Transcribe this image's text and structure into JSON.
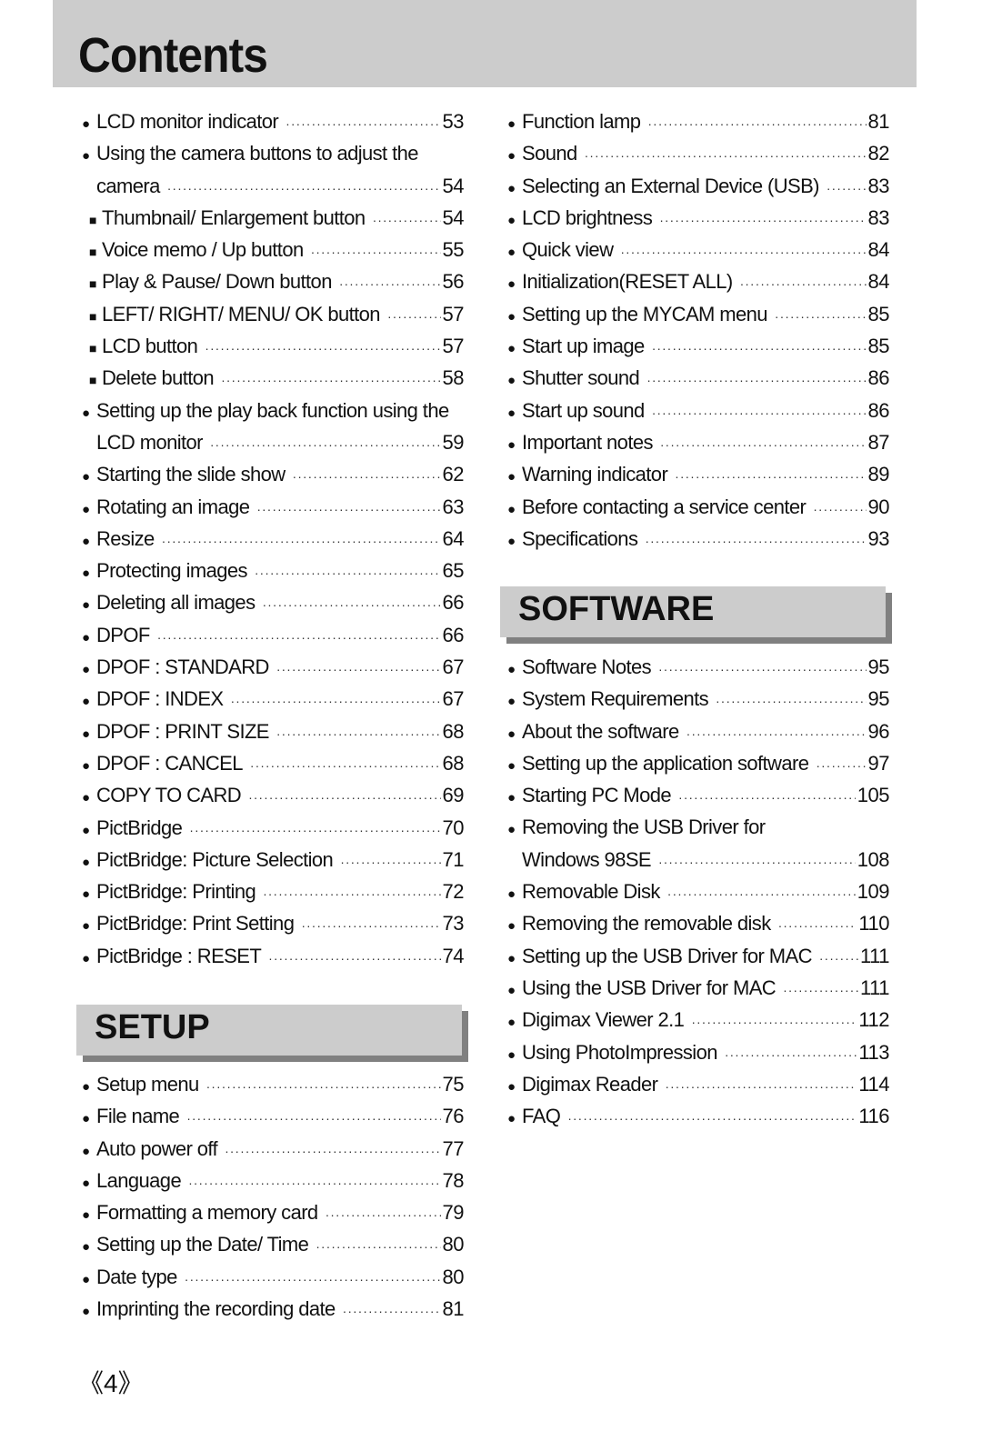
{
  "title": "Contents",
  "left_column": {
    "entries": [
      {
        "bullet": "●",
        "label": "LCD monitor indicator",
        "page": "53",
        "level": "main"
      },
      {
        "bullet": "●",
        "label": "Using the camera buttons to adjust the",
        "page": "",
        "level": "main"
      },
      {
        "bullet": "",
        "label": "camera",
        "page": "54",
        "level": "cont"
      },
      {
        "bullet": "■",
        "label": "Thumbnail/ Enlargement button",
        "page": "54",
        "level": "sub"
      },
      {
        "bullet": "■",
        "label": "Voice memo / Up button",
        "page": "55",
        "level": "sub"
      },
      {
        "bullet": "■",
        "label": "Play & Pause/ Down button",
        "page": "56",
        "level": "sub"
      },
      {
        "bullet": "■",
        "label": "LEFT/ RIGHT/ MENU/ OK button",
        "page": "57",
        "level": "sub"
      },
      {
        "bullet": "■",
        "label": "LCD button",
        "page": "57",
        "level": "sub"
      },
      {
        "bullet": "■",
        "label": "Delete button",
        "page": "58",
        "level": "sub"
      },
      {
        "bullet": "●",
        "label": "Setting up the play back function using the",
        "page": "",
        "level": "main"
      },
      {
        "bullet": "",
        "label": "LCD monitor",
        "page": "59",
        "level": "cont"
      },
      {
        "bullet": "●",
        "label": "Starting the slide show",
        "page": "62",
        "level": "main"
      },
      {
        "bullet": "●",
        "label": "Rotating an image",
        "page": "63",
        "level": "main"
      },
      {
        "bullet": "●",
        "label": "Resize",
        "page": "64",
        "level": "main"
      },
      {
        "bullet": "●",
        "label": "Protecting images",
        "page": "65",
        "level": "main"
      },
      {
        "bullet": "●",
        "label": "Deleting all images",
        "page": "66",
        "level": "main"
      },
      {
        "bullet": "●",
        "label": "DPOF",
        "page": "66",
        "level": "main"
      },
      {
        "bullet": "●",
        "label": "DPOF : STANDARD",
        "page": "67",
        "level": "main"
      },
      {
        "bullet": "●",
        "label": "DPOF : INDEX",
        "page": "67",
        "level": "main"
      },
      {
        "bullet": "●",
        "label": "DPOF : PRINT SIZE",
        "page": "68",
        "level": "main"
      },
      {
        "bullet": "●",
        "label": "DPOF : CANCEL",
        "page": "68",
        "level": "main"
      },
      {
        "bullet": "●",
        "label": "COPY TO CARD",
        "page": "69",
        "level": "main"
      },
      {
        "bullet": "●",
        "label": "PictBridge",
        "page": "70",
        "level": "main"
      },
      {
        "bullet": "●",
        "label": "PictBridge: Picture Selection",
        "page": "71",
        "level": "main"
      },
      {
        "bullet": "●",
        "label": "PictBridge: Printing",
        "page": "72",
        "level": "main"
      },
      {
        "bullet": "●",
        "label": "PictBridge: Print Setting",
        "page": "73",
        "level": "main"
      },
      {
        "bullet": "●",
        "label": "PictBridge : RESET",
        "page": "74",
        "level": "main"
      }
    ]
  },
  "setup_section": {
    "heading": "SETUP",
    "entries": [
      {
        "bullet": "●",
        "label": "Setup menu",
        "page": "75",
        "level": "main"
      },
      {
        "bullet": "●",
        "label": "File name",
        "page": "76",
        "level": "main"
      },
      {
        "bullet": "●",
        "label": "Auto power off",
        "page": "77",
        "level": "main"
      },
      {
        "bullet": "●",
        "label": "Language",
        "page": "78",
        "level": "main"
      },
      {
        "bullet": "●",
        "label": "Formatting a memory card",
        "page": "79",
        "level": "main"
      },
      {
        "bullet": "●",
        "label": "Setting up the Date/ Time",
        "page": "80",
        "level": "main"
      },
      {
        "bullet": "●",
        "label": "Date type",
        "page": "80",
        "level": "main"
      },
      {
        "bullet": "●",
        "label": "Imprinting the recording date",
        "page": "81",
        "level": "main"
      }
    ]
  },
  "right_column": {
    "entries": [
      {
        "bullet": "●",
        "label": "Function lamp",
        "page": "81",
        "level": "main"
      },
      {
        "bullet": "●",
        "label": "Sound",
        "page": "82",
        "level": "main"
      },
      {
        "bullet": "●",
        "label": "Selecting an External Device (USB)",
        "page": "83",
        "level": "main"
      },
      {
        "bullet": "●",
        "label": "LCD brightness",
        "page": "83",
        "level": "main"
      },
      {
        "bullet": "●",
        "label": "Quick view",
        "page": "84",
        "level": "main"
      },
      {
        "bullet": "●",
        "label": "Initialization(RESET ALL)",
        "page": "84",
        "level": "main"
      },
      {
        "bullet": "●",
        "label": "Setting up the MYCAM menu",
        "page": "85",
        "level": "main"
      },
      {
        "bullet": "●",
        "label": "Start up image",
        "page": "85",
        "level": "main"
      },
      {
        "bullet": "●",
        "label": "Shutter sound",
        "page": "86",
        "level": "main"
      },
      {
        "bullet": "●",
        "label": "Start up sound",
        "page": "86",
        "level": "main"
      },
      {
        "bullet": "●",
        "label": "Important notes",
        "page": "87",
        "level": "main"
      },
      {
        "bullet": "●",
        "label": "Warning indicator",
        "page": "89",
        "level": "main"
      },
      {
        "bullet": "●",
        "label": "Before contacting a service center",
        "page": "90",
        "level": "main"
      },
      {
        "bullet": "●",
        "label": "Specifications",
        "page": "93",
        "level": "main"
      }
    ]
  },
  "software_section": {
    "heading": "SOFTWARE",
    "entries": [
      {
        "bullet": "●",
        "label": "Software Notes",
        "page": "95",
        "level": "main"
      },
      {
        "bullet": "●",
        "label": "System Requirements",
        "page": "95",
        "level": "main"
      },
      {
        "bullet": "●",
        "label": "About the software",
        "page": "96",
        "level": "main"
      },
      {
        "bullet": "●",
        "label": "Setting up the application software",
        "page": "97",
        "level": "main"
      },
      {
        "bullet": "●",
        "label": "Starting PC Mode",
        "page": "105",
        "level": "main"
      },
      {
        "bullet": "●",
        "label": "Removing the USB Driver for",
        "page": "",
        "level": "main"
      },
      {
        "bullet": "",
        "label": "Windows 98SE",
        "page": "108",
        "level": "cont"
      },
      {
        "bullet": "●",
        "label": "Removable Disk",
        "page": "109",
        "level": "main"
      },
      {
        "bullet": "●",
        "label": "Removing the removable disk",
        "page": "110",
        "level": "main"
      },
      {
        "bullet": "●",
        "label": "Setting up the USB Driver for MAC",
        "page": "111",
        "level": "main"
      },
      {
        "bullet": "●",
        "label": "Using the USB Driver for MAC",
        "page": "111",
        "level": "main"
      },
      {
        "bullet": "●",
        "label": "Digimax Viewer 2.1",
        "page": "112",
        "level": "main"
      },
      {
        "bullet": "●",
        "label": "Using PhotoImpression",
        "page": "113",
        "level": "main"
      },
      {
        "bullet": "●",
        "label": "Digimax Reader",
        "page": "114",
        "level": "main"
      },
      {
        "bullet": "●",
        "label": "FAQ",
        "page": "116",
        "level": "main"
      }
    ]
  },
  "page_number": "《4》"
}
